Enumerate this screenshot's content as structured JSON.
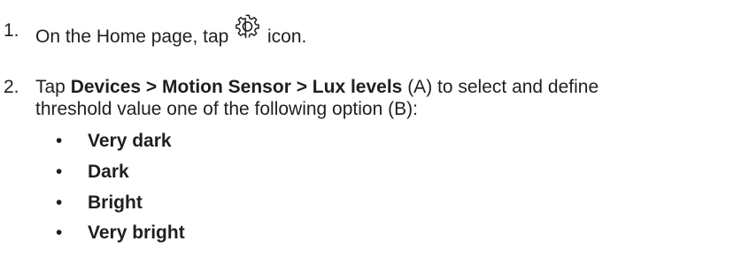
{
  "steps": [
    {
      "number": "1.",
      "text_before": "On the Home page, tap",
      "icon": "gear-icon",
      "text_after": "icon."
    },
    {
      "number": "2.",
      "prefix": "Tap ",
      "path": "Devices > Motion Sensor > Lux levels",
      "middle": " (A) to select and define",
      "line2": "threshold value one of the following option (B):"
    }
  ],
  "options": [
    {
      "bullet": "•",
      "label": "Very dark"
    },
    {
      "bullet": "•",
      "label": "Dark"
    },
    {
      "bullet": "•",
      "label": "Bright"
    },
    {
      "bullet": "•",
      "label": "Very bright"
    }
  ],
  "colors": {
    "text": "#1f1f1f",
    "background": "#ffffff"
  }
}
